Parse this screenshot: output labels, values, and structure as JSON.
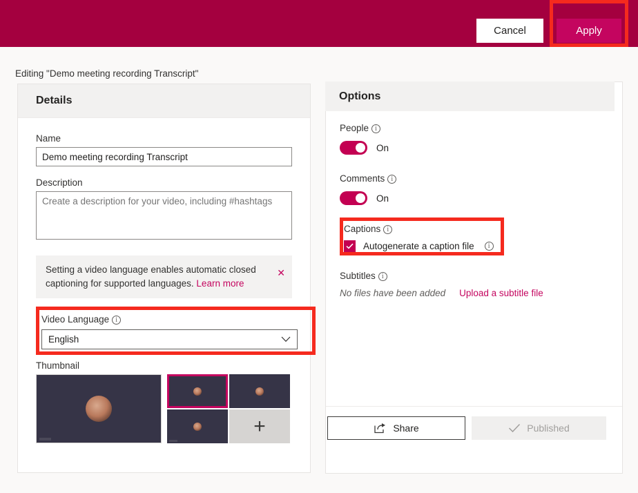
{
  "header": {
    "cancel_label": "Cancel",
    "apply_label": "Apply",
    "bar_color": "#a4003f",
    "apply_color": "#c4055f",
    "highlight_color": "#f52a1e"
  },
  "editing_line": "Editing \"Demo meeting recording Transcript\"",
  "details": {
    "title": "Details",
    "name_label": "Name",
    "name_value": "Demo meeting recording Transcript",
    "description_label": "Description",
    "description_placeholder": "Create a description for your video, including #hashtags",
    "description_value": "",
    "notice_text": "Setting a video language enables automatic closed captioning for supported languages.",
    "notice_link": "Learn more",
    "notice_close": "✕",
    "video_language_label": "Video Language",
    "video_language_value": "English",
    "chevron": "⌄",
    "thumbnail_label": "Thumbnail",
    "thumbnail_add": "+"
  },
  "options": {
    "title": "Options",
    "people_label": "People",
    "people_state": "On",
    "comments_label": "Comments",
    "comments_state": "On",
    "captions_label": "Captions",
    "captions_checkbox_label": "Autogenerate a caption file",
    "captions_checked": true,
    "subtitles_label": "Subtitles",
    "subtitles_empty": "No files have been added",
    "subtitles_link": "Upload a subtitle file",
    "share_label": "Share",
    "published_label": "Published",
    "toggle_color": "#c30052",
    "link_color": "#c4055f"
  }
}
